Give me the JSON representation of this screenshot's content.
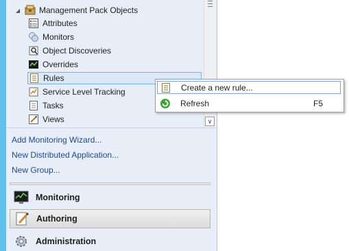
{
  "tree": {
    "root_label": "Management Pack Objects",
    "items": [
      {
        "label": "Attributes",
        "icon": "attributes-icon"
      },
      {
        "label": "Monitors",
        "icon": "monitors-icon"
      },
      {
        "label": "Object Discoveries",
        "icon": "object-discoveries-icon"
      },
      {
        "label": "Overrides",
        "icon": "overrides-icon"
      },
      {
        "label": "Rules",
        "icon": "rules-icon",
        "selected": true
      },
      {
        "label": "Service Level Tracking",
        "icon": "service-level-icon"
      },
      {
        "label": "Tasks",
        "icon": "tasks-icon"
      },
      {
        "label": "Views",
        "icon": "views-icon"
      }
    ]
  },
  "tasks": {
    "add_monitoring_wizard": "Add Monitoring Wizard...",
    "new_distributed_application": "New Distributed Application...",
    "new_group": "New Group..."
  },
  "wunderbar": {
    "monitoring": "Monitoring",
    "authoring": "Authoring",
    "administration": "Administration",
    "active": "Authoring"
  },
  "context_menu": {
    "items": [
      {
        "label": "Create a new rule...",
        "shortcut": "",
        "icon": "new-rule-icon"
      },
      {
        "label": "Refresh",
        "shortcut": "F5",
        "icon": "refresh-icon"
      }
    ]
  },
  "colors": {
    "accent_strip": "#5fc1ea",
    "nav_background": "#e8eef8",
    "link": "#1b4a8a",
    "selection_border": "#84acdd"
  }
}
